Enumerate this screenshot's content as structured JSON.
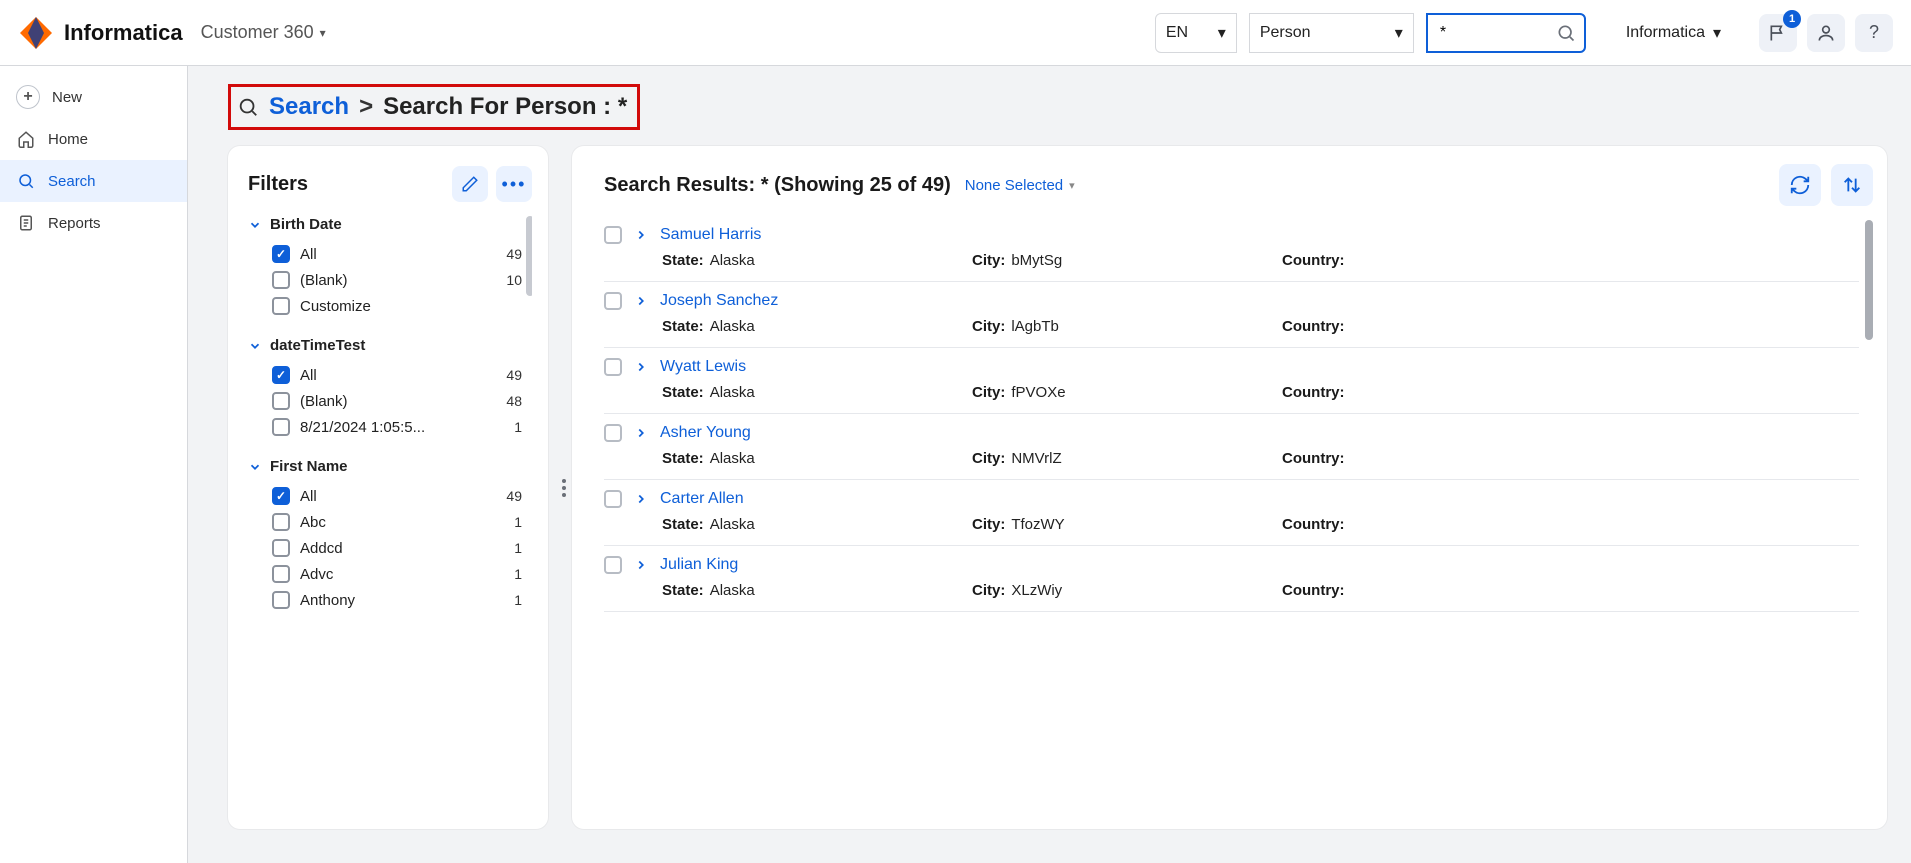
{
  "header": {
    "brand": "Informatica",
    "appName": "Customer 360",
    "langSelect": "EN",
    "typeSelect": "Person",
    "searchValue": "*",
    "orgName": "Informatica",
    "notifCount": "1"
  },
  "sidebar": {
    "new": "New",
    "home": "Home",
    "search": "Search",
    "reports": "Reports"
  },
  "breadcrumb": {
    "root": "Search",
    "sep": ">",
    "leaf": "Search For Person : *"
  },
  "filters": {
    "title": "Filters",
    "groups": [
      {
        "label": "Birth Date",
        "options": [
          {
            "label": "All",
            "count": "49",
            "checked": true
          },
          {
            "label": "(Blank)",
            "count": "10",
            "checked": false
          },
          {
            "label": "Customize",
            "count": "",
            "checked": false
          }
        ]
      },
      {
        "label": "dateTimeTest",
        "options": [
          {
            "label": "All",
            "count": "49",
            "checked": true
          },
          {
            "label": "(Blank)",
            "count": "48",
            "checked": false
          },
          {
            "label": "8/21/2024 1:05:5...",
            "count": "1",
            "checked": false
          }
        ]
      },
      {
        "label": "First Name",
        "options": [
          {
            "label": "All",
            "count": "49",
            "checked": true
          },
          {
            "label": "Abc",
            "count": "1",
            "checked": false
          },
          {
            "label": "Addcd",
            "count": "1",
            "checked": false
          },
          {
            "label": "Advc",
            "count": "1",
            "checked": false
          },
          {
            "label": "Anthony",
            "count": "1",
            "checked": false
          }
        ]
      }
    ]
  },
  "results": {
    "heading": "Search Results: * (Showing 25 of 49)",
    "noneSelected": "None Selected",
    "labels": {
      "state": "State:",
      "city": "City:",
      "country": "Country:"
    },
    "rows": [
      {
        "first": "Samuel",
        "last": "Harris",
        "state": "Alaska",
        "city": "bMytSg",
        "country": ""
      },
      {
        "first": "Joseph",
        "last": "Sanchez",
        "state": "Alaska",
        "city": "lAgbTb",
        "country": ""
      },
      {
        "first": "Wyatt",
        "last": "Lewis",
        "state": "Alaska",
        "city": "fPVOXe",
        "country": ""
      },
      {
        "first": "Asher",
        "last": "Young",
        "state": "Alaska",
        "city": "NMVrlZ",
        "country": ""
      },
      {
        "first": "Carter",
        "last": "Allen",
        "state": "Alaska",
        "city": "TfozWY",
        "country": ""
      },
      {
        "first": "Julian",
        "last": "King",
        "state": "Alaska",
        "city": "XLzWiy",
        "country": ""
      }
    ]
  }
}
